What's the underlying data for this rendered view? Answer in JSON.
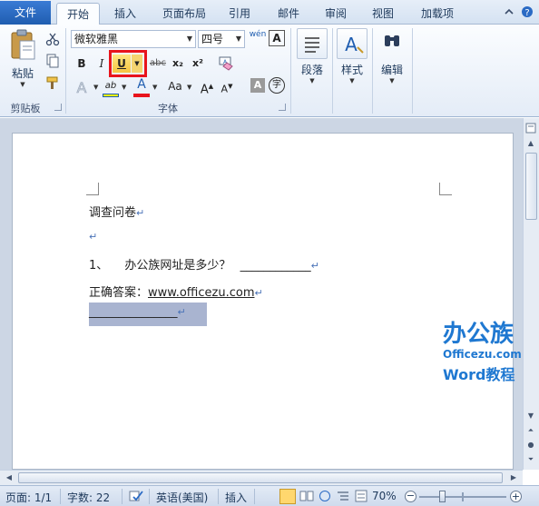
{
  "tabs": {
    "file": "文件",
    "items": [
      "开始",
      "插入",
      "页面布局",
      "引用",
      "邮件",
      "审阅",
      "视图",
      "加载项"
    ],
    "active_index": 0
  },
  "ribbon": {
    "clipboard": {
      "paste": "粘贴",
      "group": "剪贴板"
    },
    "font": {
      "font_name": "微软雅黑",
      "font_size": "四号",
      "wen_button": "wén",
      "border_char": "A",
      "bold": "B",
      "italic": "I",
      "underline": "U",
      "strike": "abc",
      "subscript": "x₂",
      "superscript": "x²",
      "highlight": "ab",
      "font_color": "A",
      "change_case": "Aa",
      "grow": "A",
      "shrink": "A",
      "shade_char": "A",
      "enclose_char": "字",
      "group": "字体"
    },
    "paragraph": {
      "label": "段落"
    },
    "styles": {
      "label": "样式"
    },
    "editing": {
      "label": "编辑"
    }
  },
  "document": {
    "title": "调查问卷",
    "q_num": "1、",
    "q_text": "办公族网址是多少？",
    "q_blank": "____________",
    "answer_label": "正确答案：",
    "answer_url": "www.officezu.com",
    "answer_blank": "_______________"
  },
  "watermark": {
    "brand": "办公族",
    "site": "Officezu.com",
    "tag": "Word教程"
  },
  "status": {
    "page": "页面: 1/1",
    "words": "字数: 22",
    "language": "英语(美国)",
    "mode": "插入",
    "zoom": "70%"
  },
  "colors": {
    "file_tab": "#2a6ac4",
    "highlight_box": "#e8141c",
    "selection": "#a9b4d0",
    "highlight_bar": "#ffff00",
    "font_color_bar": "#e8141c",
    "logo_blue": "#1f78d1"
  }
}
